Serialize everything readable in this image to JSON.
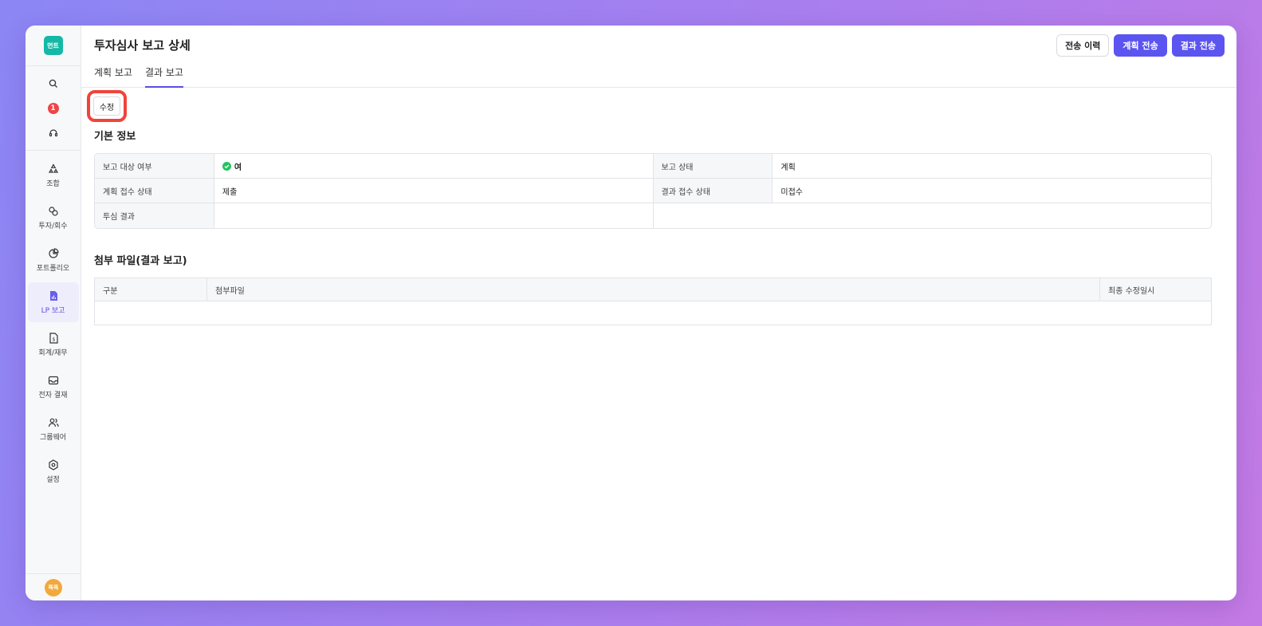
{
  "sidebar": {
    "logo_text": "먼트",
    "badge_count": "1",
    "items": [
      {
        "label": "조합",
        "icon": "recycle-icon"
      },
      {
        "label": "투자/회수",
        "icon": "money-flow-icon"
      },
      {
        "label": "포트폴리오",
        "icon": "pie-chart-icon"
      },
      {
        "label": "LP 보고",
        "icon": "report-file-icon"
      },
      {
        "label": "회계/재무",
        "icon": "dollar-file-icon"
      },
      {
        "label": "전자 결재",
        "icon": "inbox-icon"
      },
      {
        "label": "그룹웨어",
        "icon": "users-icon"
      },
      {
        "label": "설정",
        "icon": "settings-icon"
      }
    ],
    "avatar_text": "뚝뚝"
  },
  "header": {
    "title": "투자심사 보고 상세",
    "tabs": [
      {
        "label": "계획 보고"
      },
      {
        "label": "결과 보고"
      }
    ],
    "actions": {
      "history": "전송 이력",
      "send_plan": "계획 전송",
      "send_result": "결과 전송"
    }
  },
  "edit_label": "수정",
  "basic_info": {
    "title": "기본 정보",
    "report_target_label": "보고 대상 여부",
    "report_target_value": "여",
    "report_status_label": "보고 상태",
    "report_status_value": "계획",
    "plan_receipt_label": "계획 접수 상태",
    "plan_receipt_value": "제출",
    "result_receipt_label": "결과 접수 상태",
    "result_receipt_value": "미접수",
    "review_result_label": "투심 결과",
    "review_result_value": ""
  },
  "attachments": {
    "title": "첨부 파일(결과 보고)",
    "columns": [
      "구분",
      "첨부파일",
      "최종 수정일시"
    ]
  },
  "colors": {
    "primary": "#5b54f0",
    "accent_logo": "#14b8a6",
    "badge": "#ef4444",
    "highlight": "#f0443a",
    "check": "#22c55e"
  }
}
